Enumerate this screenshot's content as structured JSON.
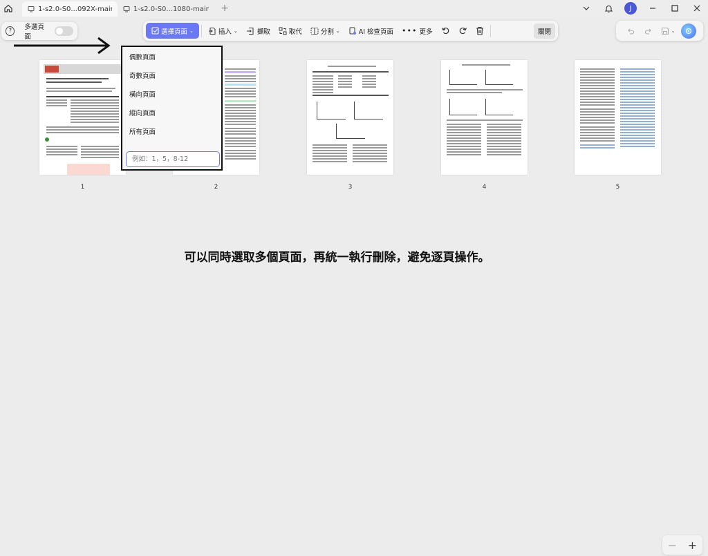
{
  "tabs": [
    {
      "label": "1-s2.0-S0...092X-main",
      "active": true
    },
    {
      "label": "1-s2.0-S0...1080-main",
      "active": false
    }
  ],
  "user": {
    "initial": "J"
  },
  "left_bar": {
    "multi_select_label": "多選頁面"
  },
  "toolbar": {
    "select_pages": "選擇頁面",
    "insert": "插入",
    "extract": "擷取",
    "replace": "取代",
    "split": "分割",
    "ai_check": "AI 檢查頁面",
    "more": "更多",
    "close": "關閉"
  },
  "dropdown": {
    "options": [
      "偶數頁面",
      "奇數頁面",
      "橫向頁面",
      "縱向頁面",
      "所有頁面"
    ],
    "range_placeholder": "例如：1，5，8-12"
  },
  "pages": [
    "1",
    "2",
    "3",
    "4",
    "5"
  ],
  "caption": "可以同時選取多個頁面，再統一執行刪除，避免逐頁操作。",
  "colors": {
    "accent": "#6a79f2",
    "avatar": "#4b57d6"
  }
}
